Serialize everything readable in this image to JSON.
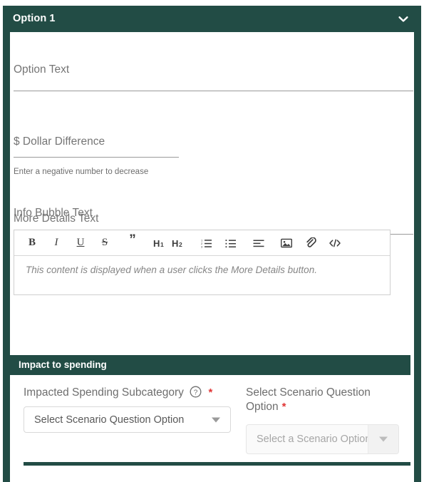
{
  "accordion": {
    "title": "Option 1",
    "chevron_icon": "chevron-down-icon",
    "expanded": true
  },
  "colors": {
    "brand_green": "#224c45",
    "required_red": "#e03434",
    "label_grey": "#757575",
    "border_grey": "#d9d9d9"
  },
  "fields": {
    "option_text": {
      "label": "Option Text",
      "value": "",
      "placeholder": "Option Text"
    },
    "dollar_difference": {
      "label": "$ Dollar Difference",
      "value": "",
      "placeholder": "$ Dollar Difference",
      "helper_text": "Enter a negative number to decrease"
    },
    "info_bubble_text": {
      "label": "Info Bubble Text",
      "value": "",
      "placeholder": "Info Bubble Text"
    }
  },
  "editor": {
    "label": "More Details Text",
    "placeholder": "This content is displayed when a user clicks the More Details button.",
    "value": "",
    "toolbar": [
      {
        "name": "bold-icon",
        "label": "B"
      },
      {
        "name": "italic-icon",
        "label": "I"
      },
      {
        "name": "underline-icon",
        "label": "U"
      },
      {
        "name": "strikethrough-icon",
        "label": "S"
      },
      {
        "name": "blockquote-icon",
        "label": "”"
      },
      {
        "name": "heading-1-icon",
        "label": "H1"
      },
      {
        "name": "heading-2-icon",
        "label": "H2"
      },
      {
        "name": "ordered-list-icon",
        "label": "1."
      },
      {
        "name": "unordered-list-icon",
        "label": "•"
      },
      {
        "name": "align-icon",
        "label": "≡"
      },
      {
        "name": "image-icon",
        "label": "Ὓc"
      },
      {
        "name": "attachment-icon",
        "label": "🔗"
      },
      {
        "name": "code-icon",
        "label": "</>"
      }
    ]
  },
  "impact_section": {
    "title": "Impact to spending",
    "subcategory": {
      "label": "Impacted Spending Subcategory",
      "help_icon": "help-circle-icon",
      "required": true,
      "required_marker": "*",
      "select_value": "Select Scenario Question Option",
      "caret_icon": "caret-down-icon",
      "disabled": false
    },
    "scenario_option": {
      "label": "Select Scenario Question Option",
      "required": true,
      "required_marker": "*",
      "select_value": "Select a Scenario Option",
      "caret_icon": "caret-down-icon",
      "disabled": true
    }
  }
}
